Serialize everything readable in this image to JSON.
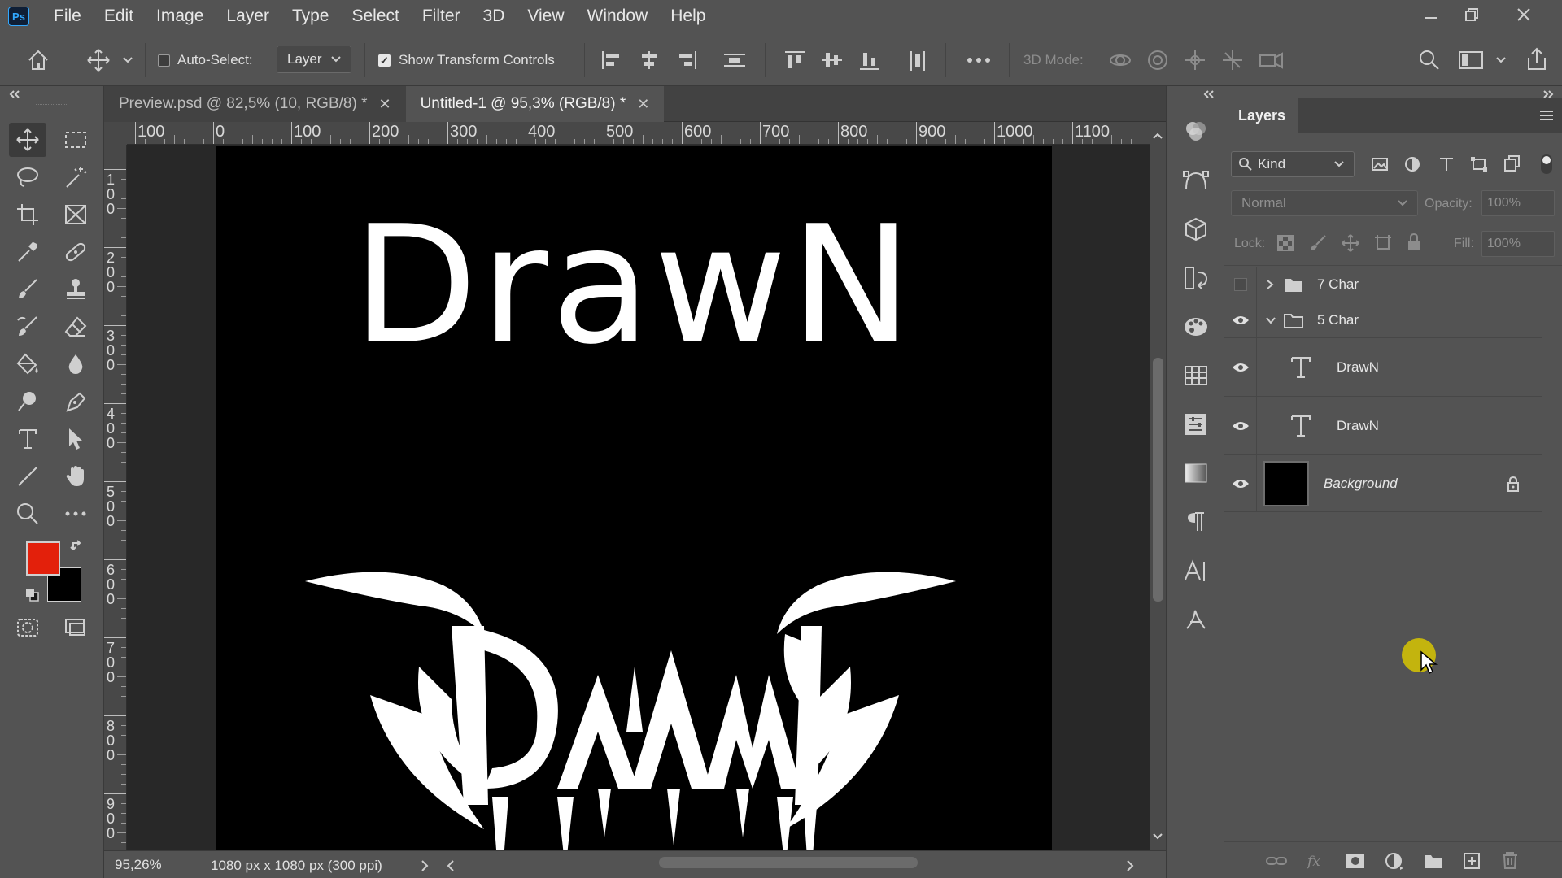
{
  "app": {
    "logo": "Ps"
  },
  "menu": [
    "File",
    "Edit",
    "Image",
    "Layer",
    "Type",
    "Select",
    "Filter",
    "3D",
    "View",
    "Window",
    "Help"
  ],
  "options": {
    "auto_select_label": "Auto-Select:",
    "auto_select_checked": false,
    "auto_select_target": "Layer",
    "show_transform_label": "Show Transform Controls",
    "show_transform_checked": true,
    "mode_3d_label": "3D Mode:"
  },
  "tabs": [
    {
      "label": "Preview.psd @ 82,5% (10, RGB/8) *",
      "active": false
    },
    {
      "label": "Untitled-1 @ 95,3% (RGB/8) *",
      "active": true
    }
  ],
  "ruler": {
    "h_ticks": [
      "100",
      "0",
      "100",
      "200",
      "300",
      "400",
      "500",
      "600",
      "700",
      "800",
      "900",
      "1000",
      "1100"
    ],
    "v_ticks": [
      "1\n0\n0",
      "2\n0\n0",
      "3\n0\n0",
      "4\n0\n0",
      "5\n0\n0",
      "6\n0\n0",
      "7\n0\n0",
      "8\n0\n0",
      "9\n0\n0"
    ]
  },
  "canvas": {
    "title_text": "DrawN",
    "background": "#000000",
    "text_color": "#ffffff"
  },
  "status": {
    "zoom": "95,26%",
    "doc_info": "1080 px x 1080 px (300 ppi)"
  },
  "colors": {
    "foreground": "#e3200b",
    "background": "#000000",
    "accent": "#31a8ff"
  },
  "layers_panel": {
    "tab_label": "Layers",
    "filter_kind": "Kind",
    "blend_mode": "Normal",
    "opacity_label": "Opacity:",
    "opacity_value": "100%",
    "lock_label": "Lock:",
    "fill_label": "Fill:",
    "fill_value": "100%",
    "layers": [
      {
        "name": "7 Char",
        "type": "group",
        "expanded": false,
        "visible": false
      },
      {
        "name": "5 Char",
        "type": "group",
        "expanded": true,
        "visible": true
      },
      {
        "name": "DrawN",
        "type": "text",
        "visible": true
      },
      {
        "name": "DrawN",
        "type": "text",
        "visible": true
      },
      {
        "name": "Background",
        "type": "pixel",
        "visible": true,
        "locked": true
      }
    ]
  }
}
